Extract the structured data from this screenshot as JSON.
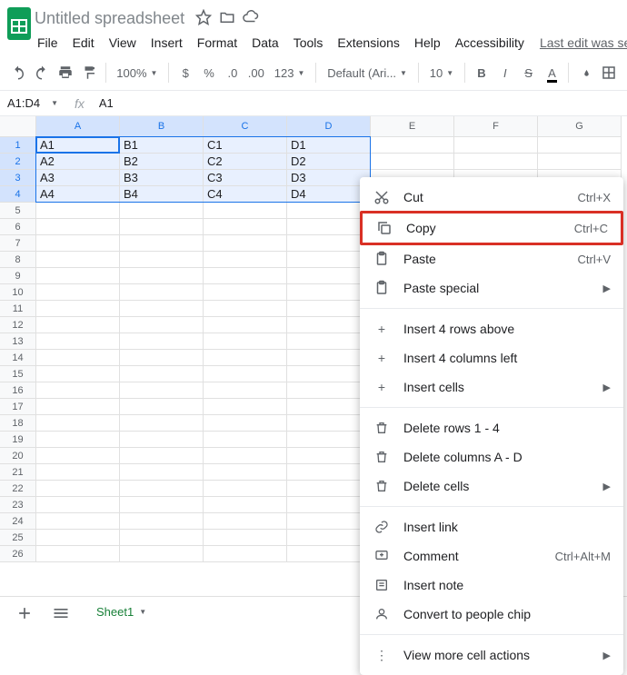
{
  "doc": {
    "title": "Untitled spreadsheet",
    "last_edit": "Last edit was second"
  },
  "menus": [
    "File",
    "Edit",
    "View",
    "Insert",
    "Format",
    "Data",
    "Tools",
    "Extensions",
    "Help",
    "Accessibility"
  ],
  "toolbar": {
    "zoom": "100%",
    "font": "Default (Ari...",
    "size": "10"
  },
  "namebox": "A1:D4",
  "fx_value": "A1",
  "columns": [
    "A",
    "B",
    "C",
    "D",
    "E",
    "F",
    "G"
  ],
  "sel_cols": [
    "A",
    "B",
    "C",
    "D"
  ],
  "sel_rows": [
    1,
    2,
    3,
    4
  ],
  "cells": [
    [
      "A1",
      "B1",
      "C1",
      "D1",
      "",
      "",
      ""
    ],
    [
      "A2",
      "B2",
      "C2",
      "D2",
      "",
      "",
      ""
    ],
    [
      "A3",
      "B3",
      "C3",
      "D3",
      "",
      "",
      ""
    ],
    [
      "A4",
      "B4",
      "C4",
      "D4",
      "",
      "",
      ""
    ]
  ],
  "num_rows": 26,
  "ctx": {
    "cut": "Cut",
    "cut_sc": "Ctrl+X",
    "copy": "Copy",
    "copy_sc": "Ctrl+C",
    "paste": "Paste",
    "paste_sc": "Ctrl+V",
    "paste_special": "Paste special",
    "ins_rows": "Insert 4 rows above",
    "ins_cols": "Insert 4 columns left",
    "ins_cells": "Insert cells",
    "del_rows": "Delete rows 1 - 4",
    "del_cols": "Delete columns A - D",
    "del_cells": "Delete cells",
    "ins_link": "Insert link",
    "comment": "Comment",
    "comment_sc": "Ctrl+Alt+M",
    "ins_note": "Insert note",
    "people_chip": "Convert to people chip",
    "more": "View more cell actions"
  },
  "sheet_tab": "Sheet1"
}
